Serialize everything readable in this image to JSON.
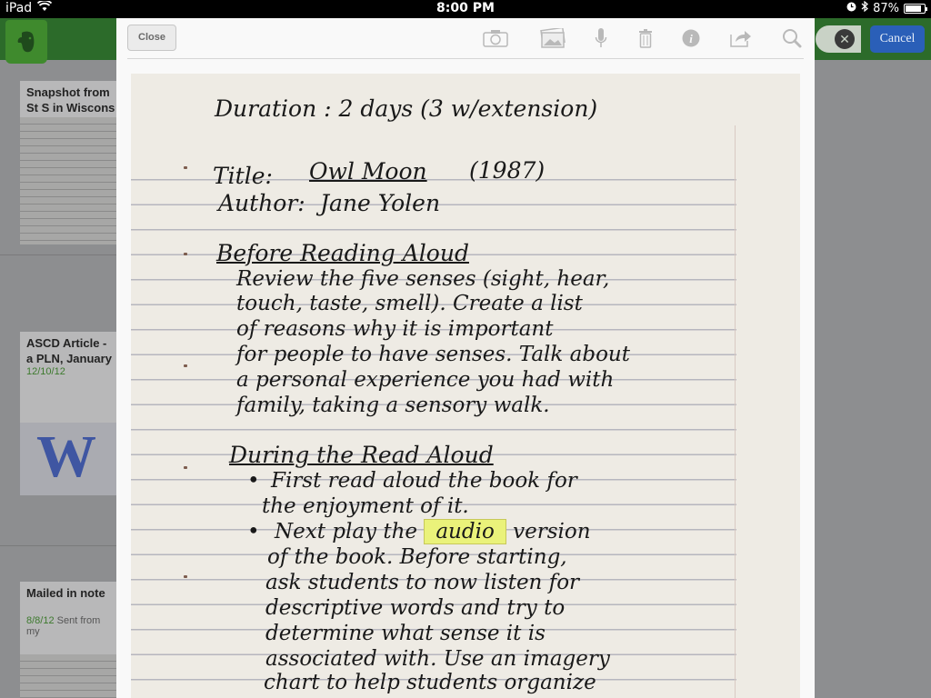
{
  "status_bar": {
    "device": "iPad",
    "time": "8:00 PM",
    "battery": "87%",
    "battery_level": 0.87
  },
  "background": {
    "header": {
      "cancel_label": "Cancel",
      "clear_icon": "clear-search-icon",
      "logo_icon": "evernote-elephant-icon"
    },
    "notes": [
      {
        "title": "Snapshot from\nSt S in Wiscons",
        "date": ""
      },
      {
        "title": "ASCD Article -\na PLN, January",
        "date": "12/10/12",
        "thumb_text": "W"
      },
      {
        "title": "Mailed in note",
        "date": "8/8/12",
        "date_suffix": "Sent from my"
      }
    ]
  },
  "modal": {
    "close_label": "Close",
    "toolbar_icons": [
      "camera-icon",
      "photos-icon",
      "microphone-icon",
      "trash-icon",
      "info-icon",
      "share-icon",
      "search-icon"
    ],
    "handwriting": {
      "duration": "Duration : 2 days (3 w/extension)",
      "title_label": "Title:",
      "title_value": "Owl Moon",
      "title_year": "(1987)",
      "author_label": "Author:",
      "author_value": "Jane Yolen",
      "before_heading": "Before Reading Aloud",
      "before_lines": [
        "Review the five senses (sight, hear,",
        "touch, taste, smell). Create a list",
        "of reasons why it is important",
        "for people to have senses. Talk about",
        "a personal experience you had with",
        "family, taking a sensory walk."
      ],
      "during_heading": "During the Read Aloud",
      "bullet_1_lines": [
        "First read aloud the book for",
        "the enjoyment of it."
      ],
      "bullet_2_start": "Next play the",
      "highlight_word": "audio",
      "bullet_2_end": "version",
      "bullet_2_lines": [
        "of the book. Before starting,",
        "ask students to now listen for",
        "descriptive words and try to",
        "determine what sense it is",
        "associated with. Use an imagery",
        "chart to help students organize"
      ],
      "bullet_mark": "•"
    }
  }
}
